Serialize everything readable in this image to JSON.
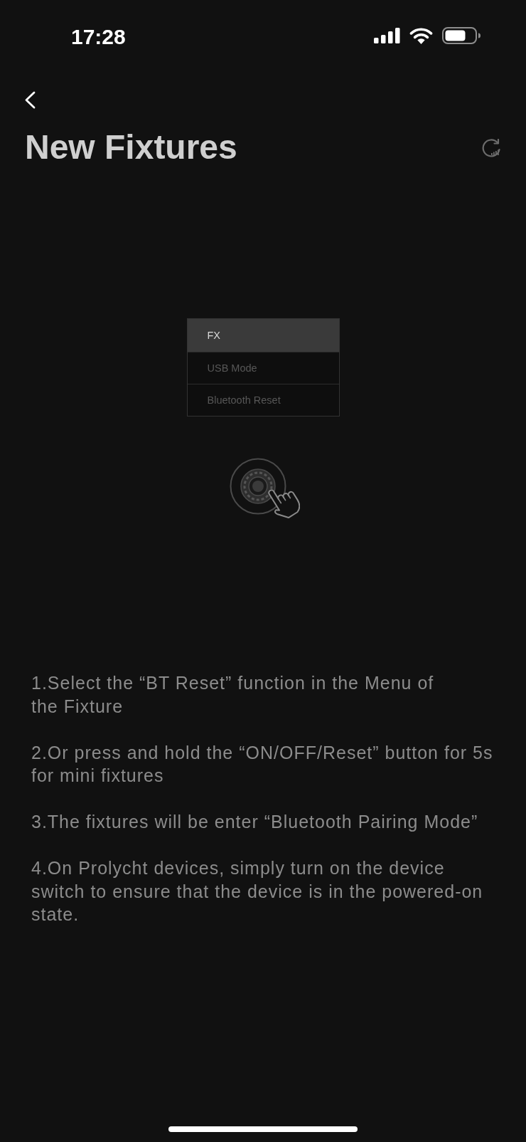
{
  "status_bar": {
    "time": "17:28"
  },
  "header": {
    "title": "New Fixtures"
  },
  "illustration": {
    "menu_items": [
      {
        "label": "FX",
        "selected": true
      },
      {
        "label": "USB Mode",
        "selected": false
      },
      {
        "label": "Bluetooth Reset",
        "selected": false
      }
    ]
  },
  "instructions": [
    "1.Select the “BT Reset” function in the Menu of\nthe Fixture",
    "2.Or press and hold the “ON/OFF/Reset” button for 5s for mini fixtures",
    "3.The fixtures will be enter “Bluetooth Pairing Mode”",
    "4.On Prolycht devices, simply turn on the device switch to ensure that the device is in the powered-on state."
  ]
}
